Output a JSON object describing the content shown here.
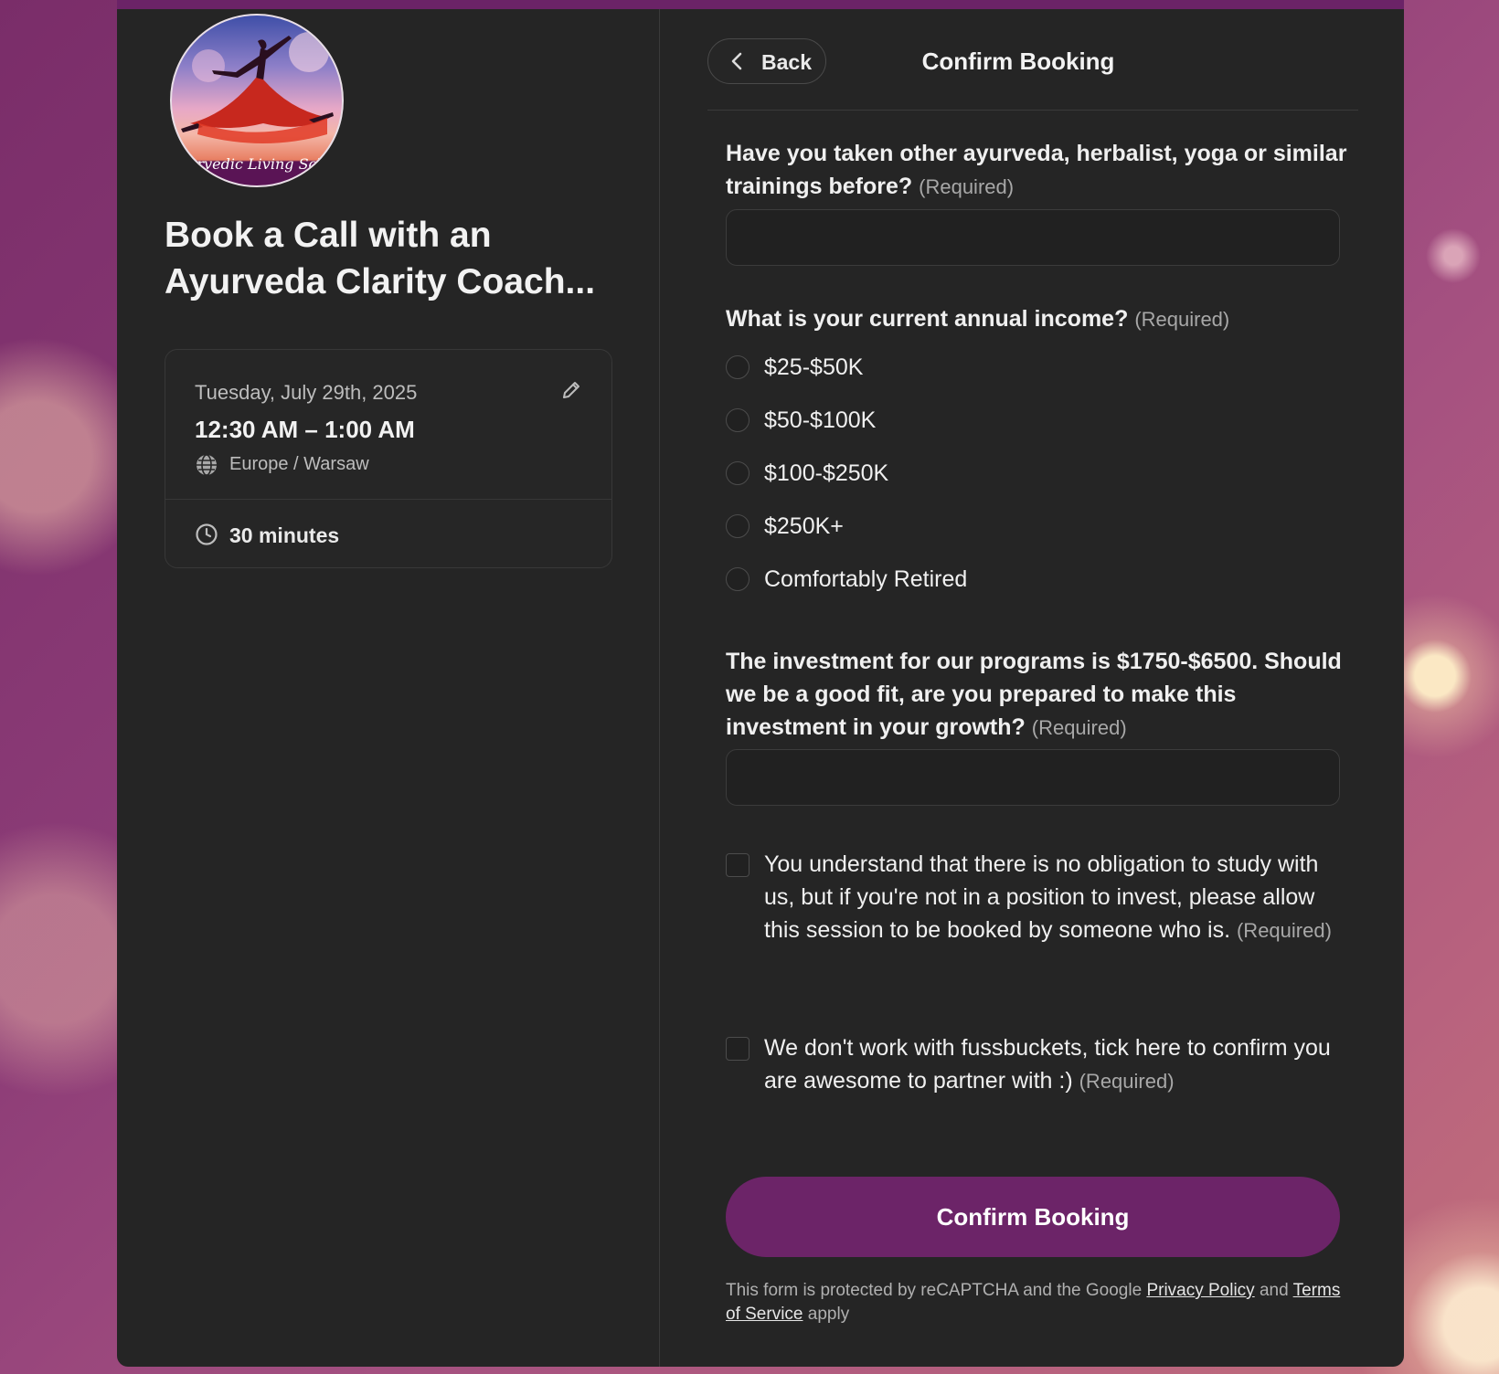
{
  "brand": {
    "accent": "#6c2468",
    "panel_bg": "#252525",
    "avatar_text": "urvedic Living Sch"
  },
  "event": {
    "title": "Book a Call with an Ayurveda Clarity Coach...",
    "date": "Tuesday, July 29th, 2025",
    "time": "12:30 AM – 1:00 AM",
    "timezone": "Europe / Warsaw",
    "duration": "30 minutes"
  },
  "header": {
    "back_label": "Back",
    "title": "Confirm Booking"
  },
  "form": {
    "required_tag": "(Required)",
    "q1": {
      "label": "Have you taken other ayurveda, herbalist, yoga or similar trainings before?",
      "value": "",
      "placeholder": ""
    },
    "q2": {
      "label": "What is your current annual income?",
      "options": [
        "$25-$50K",
        "$50-$100K",
        "$100-$250K",
        "$250K+",
        "Comfortably Retired"
      ],
      "selected": null
    },
    "q3": {
      "label": "The investment for our programs is $1750-$6500. Should we be a good fit, are you prepared to make this investment in your growth?",
      "value": "",
      "placeholder": ""
    },
    "c1": {
      "label": "You understand that there is no obligation to study with us, but if you're not in a position to invest, please allow this session to be booked by someone who is.",
      "checked": false
    },
    "c2": {
      "label": "We don't work with fussbuckets, tick here to confirm you are awesome to partner with :)",
      "checked": false
    },
    "submit_label": "Confirm Booking"
  },
  "legal": {
    "prefix": "This form is protected by reCAPTCHA and the Google",
    "privacy_link": "Privacy Policy",
    "middle": "and",
    "terms_link": "Terms of Service",
    "suffix": "apply"
  },
  "icons": {
    "edit": "pencil-icon",
    "timezone": "globe-icon",
    "duration": "clock-icon",
    "back": "chevron-left-icon"
  }
}
